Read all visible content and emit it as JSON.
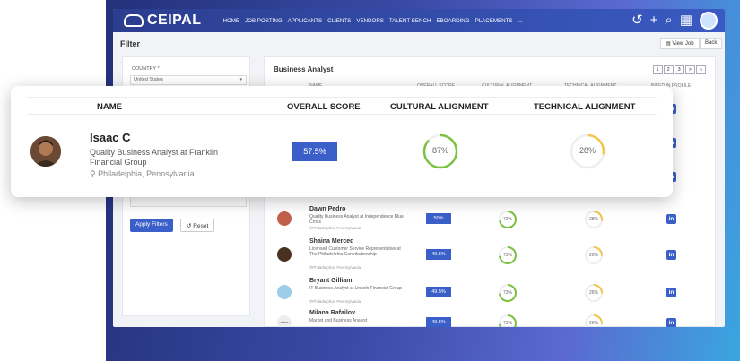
{
  "app": {
    "logo_text": "CEIPAL",
    "nav": [
      "HOME",
      "JOB POSTING",
      "APPLICANTS",
      "CLIENTS",
      "VENDORS",
      "TALENT BENCH",
      "EBOARDING",
      "PLACEMENTS",
      "..."
    ],
    "icons": [
      "history-icon",
      "plus-icon",
      "search-icon",
      "grid-icon"
    ]
  },
  "filter": {
    "title": "Filter",
    "view_job_label": "View Job",
    "back_label": "Back",
    "country_label": "COUNTRY *",
    "country_value": "United States",
    "apply_label": "Apply Filters",
    "reset_label": "Reset"
  },
  "results": {
    "title": "Business Analyst",
    "pages": [
      "1",
      "2",
      "3",
      ">",
      "»"
    ],
    "columns": [
      "NAME",
      "OVERALL SCORE",
      "CULTURAL ALIGNMENT",
      "TECHNICAL ALIGNMENT",
      "LINKED IN PROFILE"
    ],
    "rows": [
      {
        "name": "Dawn Pedro",
        "title": "Quality Business Analyst at Independence Blue Cross",
        "location": "Philadelphia, Pennsylvania",
        "score": "50%",
        "cultural": "72%",
        "cultural_value": 72,
        "technical": "28%",
        "technical_value": 28,
        "linkedin": "in"
      },
      {
        "name": "Shaina Merced",
        "title": "Licensed Customer Service Representative at The Philadelphia Contributionship",
        "location": "Philadelphia, Pennsylvania",
        "score": "49.5%",
        "cultural": "73%",
        "cultural_value": 73,
        "technical": "26%",
        "technical_value": 26,
        "linkedin": "in"
      },
      {
        "name": "Bryant Gilliam",
        "title": "IT Business Analyst at Lincoln Financial Group",
        "location": "Philadelphia, Pennsylvania",
        "score": "49.5%",
        "cultural": "73%",
        "cultural_value": 73,
        "technical": "26%",
        "technical_value": 26,
        "linkedin": "in"
      },
      {
        "name": "Milana Rafailov",
        "title": "Market and Business Analyst",
        "location": "",
        "score": "49.5%",
        "cultural": "73%",
        "cultural_value": 73,
        "technical": "26%",
        "technical_value": 26,
        "linkedin": "in",
        "avatar_text": "radian"
      }
    ]
  },
  "card": {
    "columns": [
      "NAME",
      "OVERALL SCORE",
      "CULTURAL ALIGNMENT",
      "TECHNICAL ALIGNMENT"
    ],
    "name": "Isaac C",
    "title": "Quality Business Analyst at Franklin Financial Group",
    "location": "Philadelphia, Pennsylvania",
    "score": "57.5%",
    "cultural": "87%",
    "cultural_value": 87,
    "technical": "28%",
    "technical_value": 28
  },
  "colors": {
    "primary": "#3b5fc8",
    "ring_green": "#7cc242",
    "ring_yellow": "#f3c64a"
  }
}
